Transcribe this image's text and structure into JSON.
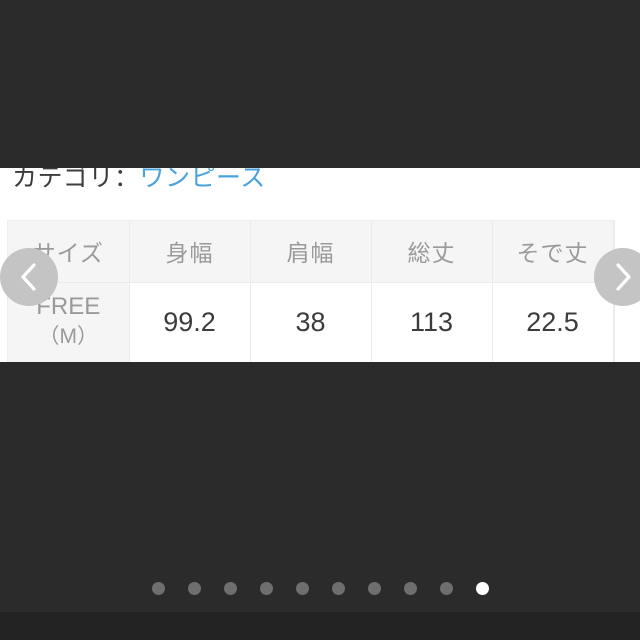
{
  "colors": {
    "backdrop": "#2b2b2b",
    "footer": "#232323",
    "link": "#4ba3d9",
    "text": "#3c3c3c",
    "muted": "#9a9a9a",
    "header_bg": "#f5f5f5",
    "arrow_bg": "#c4c4c4",
    "dot_inactive": "#6e6e6e",
    "dot_active": "#ffffff"
  },
  "category": {
    "label": "カテゴリ：",
    "value": "ワンピース"
  },
  "size_table": {
    "headers": [
      "サイズ",
      "身幅",
      "肩幅",
      "総丈",
      "そで丈"
    ],
    "rows": [
      {
        "size_name": "FREE",
        "size_sub": "（M）",
        "values": [
          "99.2",
          "38",
          "113",
          "22.5"
        ]
      }
    ]
  },
  "carousel": {
    "prev_icon": "chevron-left-icon",
    "next_icon": "chevron-right-icon",
    "total_dots": 10,
    "active_index": 9
  }
}
